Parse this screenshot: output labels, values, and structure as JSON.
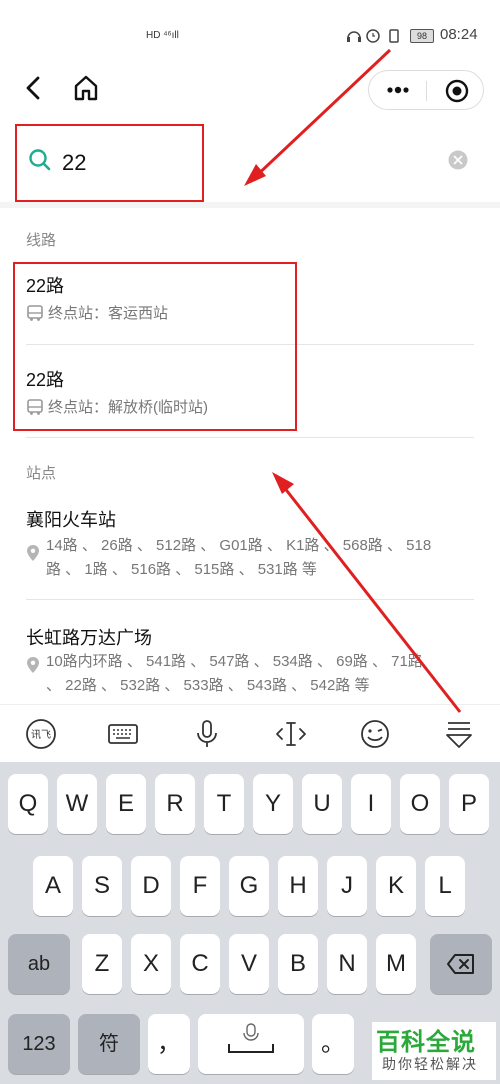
{
  "status_bar": {
    "network": "HD ⁴⁶ıll",
    "battery": "98",
    "time": "08:24"
  },
  "nav": {
    "back_icon": "chevron-left-icon",
    "home_icon": "home-icon",
    "more_icon": "more-dots-icon",
    "close_icon": "target-icon"
  },
  "search": {
    "value": "22",
    "placeholder": ""
  },
  "lines_section": {
    "title": "线路",
    "items": [
      {
        "name": "22路",
        "terminal": "终点站：客运西站"
      },
      {
        "name": "22路",
        "terminal": "终点站：解放桥(临时站)"
      }
    ]
  },
  "stops_section": {
    "title": "站点",
    "items": [
      {
        "name": "襄阳火车站",
        "routes_line1": "14路 、 26路 、 512路 、 G01路 、 K1路 、 568路 、 518",
        "routes_line2": "路 、 1路 、 516路 、 515路 、 531路 等"
      },
      {
        "name": "长虹路万达广场",
        "routes_line1": "10路内环路 、 541路 、 547路 、 534路 、 69路 、 71路",
        "routes_line2": "、 22路 、 532路 、 533路 、 543路 、 542路 等"
      }
    ]
  },
  "keyboard": {
    "row1": [
      "Q",
      "W",
      "E",
      "R",
      "T",
      "Y",
      "U",
      "I",
      "O",
      "P"
    ],
    "row2": [
      "A",
      "S",
      "D",
      "F",
      "G",
      "H",
      "J",
      "K",
      "L"
    ],
    "row3": [
      "Z",
      "X",
      "C",
      "V",
      "B",
      "N",
      "M"
    ],
    "ab": "ab",
    "num": "123",
    "sym": "符",
    "comma": "，",
    "period": "。"
  },
  "watermark": {
    "title": "百科全说",
    "subtitle": "助你轻松解决"
  },
  "colors": {
    "accent": "#1aad8e",
    "annotation": "#e02020",
    "watermark": "#2aa83a"
  }
}
